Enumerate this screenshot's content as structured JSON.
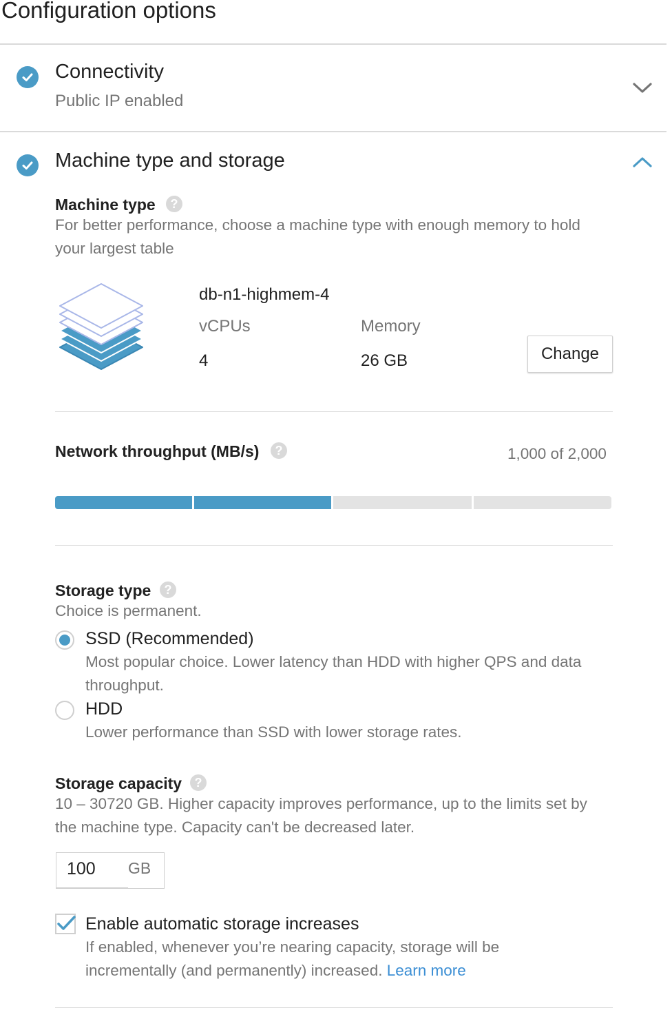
{
  "page": {
    "title": "Configuration options"
  },
  "colors": {
    "accent": "#4a9bc6",
    "link": "#3b8ed4",
    "muted": "#757575"
  },
  "connectivity": {
    "title": "Connectivity",
    "subtitle": "Public IP enabled",
    "status_icon": "check-circle-icon",
    "toggle_icon": "chevron-down-icon",
    "expanded": false
  },
  "machine_storage": {
    "title": "Machine type and storage",
    "status_icon": "check-circle-icon",
    "toggle_icon": "chevron-up-icon",
    "expanded": true,
    "machine_type": {
      "label": "Machine type",
      "help_icon": "help-icon",
      "description": "For better performance, choose a machine type with enough memory to hold your largest table",
      "illustration_icon": "stacked-layers-icon",
      "name": "db-n1-highmem-4",
      "vcpus_label": "vCPUs",
      "vcpus_value": "4",
      "memory_label": "Memory",
      "memory_value": "26 GB",
      "change_label": "Change"
    },
    "network": {
      "label": "Network throughput (MB/s)",
      "help_icon": "help-icon",
      "value_text": "1,000 of 2,000",
      "fraction": 0.5,
      "segments": 4,
      "filled_segments": 2
    },
    "storage_type": {
      "label": "Storage type",
      "help_icon": "help-icon",
      "description": "Choice is permanent.",
      "options": [
        {
          "label": "SSD (Recommended)",
          "description": "Most popular choice. Lower latency than HDD with higher QPS and data throughput.",
          "selected": true
        },
        {
          "label": "HDD",
          "description": "Lower performance than SSD with lower storage rates.",
          "selected": false
        }
      ]
    },
    "storage_capacity": {
      "label": "Storage capacity",
      "help_icon": "help-icon",
      "description": "10 – 30720 GB. Higher capacity improves performance, up to the limits set by the machine type. Capacity can't be decreased later.",
      "value": "100",
      "unit": "GB"
    },
    "auto_increase": {
      "checked": true,
      "label": "Enable automatic storage increases",
      "description": "If enabled, whenever you’re nearing capacity, storage will be incrementally (and permanently) increased.",
      "link_text": "Learn more"
    }
  }
}
